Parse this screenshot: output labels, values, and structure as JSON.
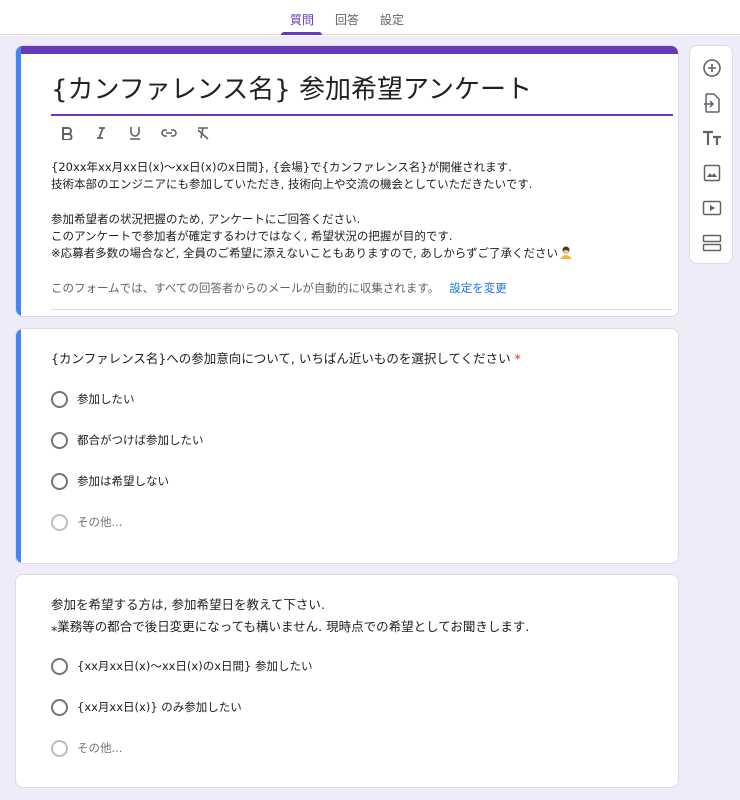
{
  "tabs": [
    {
      "label": "質問",
      "active": true
    },
    {
      "label": "回答",
      "active": false
    },
    {
      "label": "設定",
      "active": false
    }
  ],
  "colors": {
    "accent": "#673ab7",
    "focus_stripe": "#4285f4",
    "background": "#f0ebf8",
    "required": "#d93025",
    "link": "#1a73e8"
  },
  "form": {
    "title": "{カンファレンス名} 参加希望アンケート",
    "format_toolbar": [
      "bold-icon",
      "italic-icon",
      "underline-icon",
      "link-icon",
      "clear-format-icon"
    ],
    "description_lines": [
      "{20xx年xx月xx日(x)〜xx日(x)のx日間}, {会場}で{カンファレンス名}が開催されます.",
      "技術本部のエンジニアにも参加していただき, 技術向上や交流の機会としていただきたいです.",
      "",
      "参加希望者の状況把握のため, アンケートにご回答ください.",
      "このアンケートで参加者が確定するわけではなく, 希望状況の把握が目的です.",
      "※応募者多数の場合など, 全員のご希望に添えないこともありますので, あしからずご了承ください"
    ],
    "email_note": "このフォームでは、すべての回答者からのメールが自動的に収集されます。",
    "email_link": "設定を変更"
  },
  "questions": [
    {
      "title": "{カンファレンス名}への参加意向について, いちばん近いものを選択してください",
      "required_mark": "*",
      "options": [
        "参加したい",
        "都合がつけば参加したい",
        "参加は希望しない"
      ],
      "other_label": "その他..."
    },
    {
      "title_lines": [
        "参加を希望する方は, 参加希望日を教えて下さい.",
        "⁎業務等の都合で後日変更になっても構いません. 現時点での希望としてお聞きします."
      ],
      "options": [
        "{xx月xx日(x)〜xx日(x)のx日間} 参加したい",
        "{xx月xx日(x)} のみ参加したい"
      ],
      "other_label": "その他..."
    }
  ],
  "side_toolbar": [
    "add-question-icon",
    "import-questions-icon",
    "add-title-icon",
    "add-image-icon",
    "add-video-icon",
    "add-section-icon"
  ]
}
